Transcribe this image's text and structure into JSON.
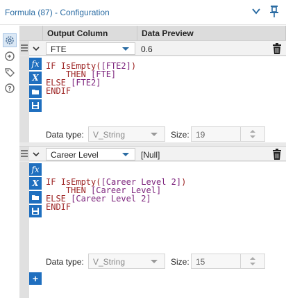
{
  "window": {
    "title": "Formula (87) - Configuration"
  },
  "rail": {
    "icons": [
      "gear-icon",
      "connection-icon",
      "tag-icon",
      "help-icon"
    ]
  },
  "headers": {
    "output_column": "Output Column",
    "data_preview": "Data Preview"
  },
  "rows": [
    {
      "column": "FTE",
      "preview": "0.6",
      "code_lines": [
        [
          {
            "t": "IF ",
            "c": "kw"
          },
          {
            "t": "IsEmpty",
            "c": "fn"
          },
          {
            "t": "(",
            "c": "kw"
          },
          {
            "t": "[FTE2]",
            "c": "fld"
          },
          {
            "t": ")",
            "c": "kw"
          }
        ],
        [
          {
            "t": "    THEN ",
            "c": "kw"
          },
          {
            "t": "[FTE]",
            "c": "fld"
          }
        ],
        [
          {
            "t": "ELSE ",
            "c": "kw"
          },
          {
            "t": "[FTE2]",
            "c": "fld"
          }
        ],
        [
          {
            "t": "ENDIF",
            "c": "kw"
          }
        ]
      ],
      "data_type_label": "Data type:",
      "data_type": "V_String",
      "size_label": "Size:",
      "size": "19"
    },
    {
      "column": "Career Level",
      "preview": "[Null]",
      "code_lines": [
        [
          {
            "t": "IF ",
            "c": "kw"
          },
          {
            "t": "IsEmpty",
            "c": "fn"
          },
          {
            "t": "(",
            "c": "kw"
          },
          {
            "t": "[Career Level 2]",
            "c": "fld"
          },
          {
            "t": ")",
            "c": "kw"
          }
        ],
        [
          {
            "t": "    THEN ",
            "c": "kw"
          },
          {
            "t": "[Career Level]",
            "c": "fld"
          }
        ],
        [
          {
            "t": "ELSE ",
            "c": "kw"
          },
          {
            "t": "[Career Level 2]",
            "c": "fld"
          }
        ],
        [
          {
            "t": "ENDIF",
            "c": "kw"
          }
        ]
      ],
      "data_type_label": "Data type:",
      "data_type": "V_String",
      "size_label": "Size:",
      "size": "15"
    }
  ],
  "tools": {
    "function_glyph": "fx",
    "variable_glyph": "X",
    "add_glyph": "+"
  },
  "colors": {
    "accent": "#1f6fbf",
    "title": "#2b6ca3",
    "keyword": "#9b1f1f",
    "field": "#7a1f7a"
  }
}
